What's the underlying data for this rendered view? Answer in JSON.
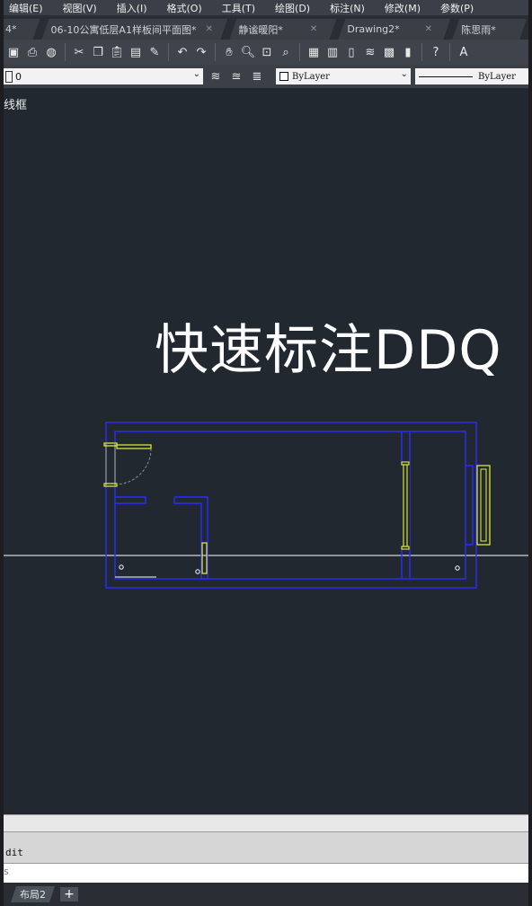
{
  "menu": [
    "编辑(E)",
    "视图(V)",
    "插入(I)",
    "格式(O)",
    "工具(T)",
    "绘图(D)",
    "标注(N)",
    "修改(M)",
    "参数(P)"
  ],
  "tabs": [
    {
      "label": "4*"
    },
    {
      "label": "06-10公寓低层A1样板间平面图*"
    },
    {
      "label": "静谧暖阳*"
    },
    {
      "label": "Drawing2*"
    },
    {
      "label": "陈思雨*"
    }
  ],
  "tab_close_glyph": "✕",
  "toolbar_icons": [
    "open-icon",
    "print-icon",
    "preview-icon",
    "publish-icon",
    "cut-icon",
    "copy-icon",
    "paste-icon",
    "match-prop-icon",
    "block-icon",
    "undo-icon",
    "redo-icon",
    "pan-icon",
    "zoom-realtime-icon",
    "zoom-window-icon",
    "zoom-previous-icon",
    "properties-icon",
    "design-center-icon",
    "tool-palette-icon",
    "sheet-set-icon",
    "markup-icon",
    "calculator-icon",
    "help-icon",
    "text-style-icon"
  ],
  "layer": {
    "current": "0"
  },
  "properties": {
    "color": "ByLayer",
    "linetype": "ByLayer"
  },
  "viewport": {
    "label": "线框",
    "overlay_title": "快速标注DDQ"
  },
  "colors": {
    "walls": "#2b2bff",
    "openings": "#e8f23a",
    "background": "#212830"
  },
  "command": {
    "history": "dit",
    "prompt": "s"
  },
  "layout_tabs": [
    {
      "label": "布局2"
    }
  ],
  "add_tab_label": "+"
}
